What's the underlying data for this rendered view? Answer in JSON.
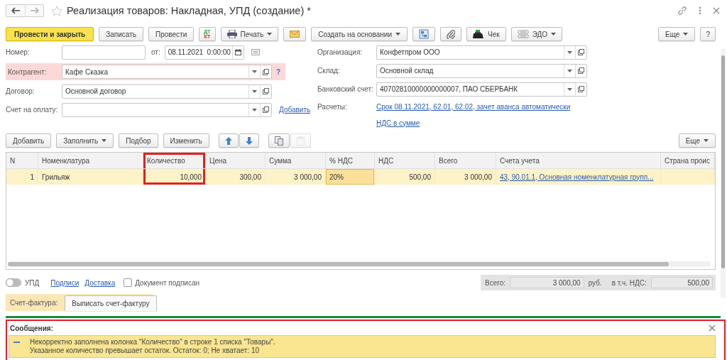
{
  "window": {
    "title": "Реализация товаров: Накладная, УПД (создание) *",
    "favorite": false
  },
  "toolbar": {
    "left": [
      {
        "kind": "primary",
        "label": "Провести и закрыть",
        "dropdown": false
      },
      {
        "kind": "plain",
        "label": "Записать",
        "dropdown": false
      },
      {
        "kind": "plain",
        "label": "Провести",
        "dropdown": false
      },
      {
        "kind": "dtkt",
        "label": "ДТ",
        "sublabel": "КТ",
        "dropdown": false
      },
      {
        "kind": "print",
        "label": "Печать",
        "dropdown": true
      },
      {
        "kind": "mail",
        "dropdown": false
      },
      {
        "kind": "plain",
        "label": "Создать на основании",
        "dropdown": true
      },
      {
        "kind": "structure",
        "dropdown": false
      },
      {
        "kind": "clip",
        "dropdown": false
      },
      {
        "kind": "receipt",
        "label": "Чек",
        "dropdown": false
      },
      {
        "kind": "edo",
        "label": "ЭДО",
        "dropdown": true
      }
    ],
    "right": [
      {
        "kind": "plain",
        "label": "Еще",
        "dropdown": true
      },
      {
        "kind": "plain",
        "label": "?",
        "dropdown": false
      }
    ]
  },
  "form": {
    "left": [
      {
        "kind": "number",
        "label": "Номер:",
        "date_label": "от:",
        "date": "08.11.2021  0:00:00"
      },
      {
        "kind": "select",
        "label": "Контрагент:",
        "value": "Кафе Сказка",
        "error": true,
        "error_mark": "?"
      },
      {
        "kind": "select",
        "label": "Договор:",
        "value": "Основной договор",
        "error": false
      },
      {
        "kind": "select",
        "label": "Счет на оплату:",
        "error": false,
        "link": "Добавить"
      }
    ],
    "right": [
      {
        "kind": "select",
        "label": "Организация:",
        "value": "Конфетпром ООО",
        "error": false
      },
      {
        "kind": "select",
        "label": "Склад:",
        "value": "Основной склад",
        "error": false
      },
      {
        "kind": "select",
        "label": "Банковский счет:",
        "value": "40702810000000000007, ПАО СБЕРБАНК",
        "error": false
      },
      {
        "kind": "link",
        "label": "Расчеты:",
        "link": "Срок 08.11.2021, 62.01, 62.02, зачет аванса автоматически"
      },
      {
        "kind": "link",
        "link": "НДС в сумме"
      }
    ]
  },
  "table_toolbar": {
    "left": [
      {
        "kind": "plain",
        "label": "Добавить",
        "dropdown": false,
        "disabled": false
      },
      {
        "kind": "plain",
        "label": "Заполнить",
        "dropdown": true,
        "disabled": false
      },
      {
        "kind": "plain",
        "label": "Подбор",
        "dropdown": false,
        "disabled": false
      },
      {
        "kind": "plain",
        "label": "Изменить",
        "dropdown": false,
        "disabled": false
      },
      {
        "kind": "up",
        "dropdown": false,
        "disabled": false
      },
      {
        "kind": "down",
        "dropdown": false,
        "disabled": false
      },
      {
        "kind": "copy",
        "dropdown": false,
        "disabled": false
      },
      {
        "kind": "paste",
        "dropdown": false,
        "disabled": true
      }
    ],
    "right": [
      {
        "kind": "plain",
        "label": "Еще",
        "dropdown": true,
        "disabled": false
      }
    ]
  },
  "table": {
    "columns": [
      {
        "label": "N",
        "kind": "number",
        "highlighted": false
      },
      {
        "label": "Номенклатура",
        "kind": "text",
        "highlighted": false
      },
      {
        "label": "Количество",
        "kind": "number",
        "highlighted": true
      },
      {
        "label": "Цена",
        "kind": "number",
        "highlighted": false
      },
      {
        "label": "Сумма",
        "kind": "number",
        "highlighted": false
      },
      {
        "label": "% НДС",
        "kind": "text",
        "highlighted": false
      },
      {
        "label": "НДС",
        "kind": "number",
        "highlighted": false
      },
      {
        "label": "Всего",
        "kind": "number",
        "highlighted": false
      },
      {
        "label": "Счета учета",
        "kind": "link",
        "highlighted": false
      },
      {
        "label": "Страна проис",
        "kind": "text",
        "highlighted": false
      }
    ],
    "rows": [
      {
        "selected": true,
        "cells": [
          {
            "text": "1",
            "focused": false
          },
          {
            "text": "Грильяж",
            "focused": false
          },
          {
            "text": "10,000",
            "focused": false
          },
          {
            "text": "300,00",
            "focused": false
          },
          {
            "text": "3 000,00",
            "focused": false
          },
          {
            "text": "20%",
            "focused": true
          },
          {
            "text": "500,00",
            "focused": false
          },
          {
            "text": "3 000,00",
            "focused": false
          },
          {
            "text": "43, 90.01.1, Основная номенклатурная групп...",
            "focused": false
          }
        ]
      }
    ]
  },
  "footer": {
    "toggle": {
      "label": "УПД",
      "on": false
    },
    "links": [
      "Подписи",
      "Доставка"
    ],
    "checkbox": {
      "label": "Документ подписан",
      "checked": false
    },
    "totals": {
      "total_label": "Всего:",
      "total": "3 000,00",
      "currency": "руб.",
      "vat_label": "в т.ч. НДС:",
      "vat": "500,00"
    }
  },
  "invoice": {
    "label": "Счет-фактура:",
    "button": "Выписать счет-фактуру"
  },
  "messages": {
    "title": "Сообщения:",
    "highlighted": true,
    "items": [
      {
        "text": "Некорректно заполнена колонка \"Количество\" в строке 1 списка \"Товары\".\nУказанное количество превышает остаток. Остаток: 0; Не хватает: 10"
      }
    ]
  }
}
